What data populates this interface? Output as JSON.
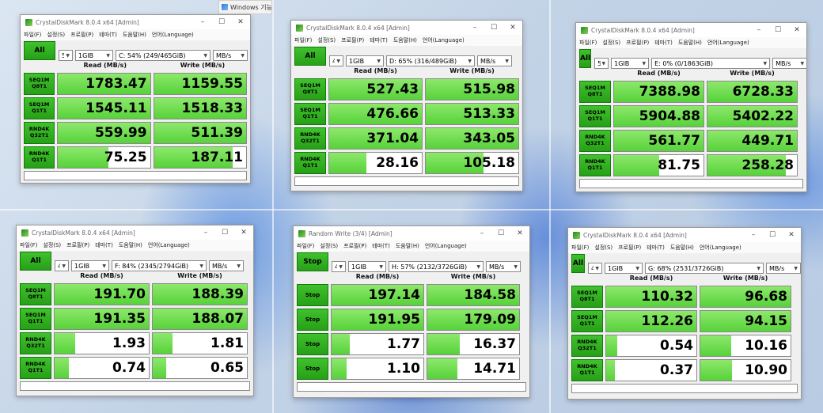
{
  "background_tab": {
    "label": "Windows 기능 P"
  },
  "common": {
    "menu": [
      "파일(F)",
      "설정(S)",
      "프로필(P)",
      "테마(T)",
      "도움말(H)",
      "언어(Language)"
    ],
    "read_header": "Read (MB/s)",
    "write_header": "Write (MB/s)",
    "count": "5",
    "size": "1GIB"
  },
  "windows": [
    {
      "title": "CrystalDiskMark 8.0.4 x64 [Admin]",
      "action": "All",
      "count": "5",
      "size": "1GIB",
      "drive": "C: 54% (249/465GiB)",
      "unit": "MB/s",
      "tests": [
        {
          "t1": "SEQ1M",
          "t2": "Q8T1",
          "read": "1783.47",
          "write": "1159.55",
          "rf": 1.0,
          "wf": 1.0
        },
        {
          "t1": "SEQ1M",
          "t2": "Q1T1",
          "read": "1545.11",
          "write": "1518.33",
          "rf": 1.0,
          "wf": 1.0
        },
        {
          "t1": "RND4K",
          "t2": "Q32T1",
          "read": "559.99",
          "write": "511.39",
          "rf": 1.0,
          "wf": 1.0
        },
        {
          "t1": "RND4K",
          "t2": "Q1T1",
          "read": "75.25",
          "write": "187.11",
          "rf": 0.55,
          "wf": 0.85
        }
      ]
    },
    {
      "title": "CrystalDiskMark 8.0.4 x64 [Admin]",
      "action": "All",
      "count": "4",
      "size": "1GIB",
      "drive": "D: 65% (316/489GiB)",
      "unit": "MB/s",
      "tests": [
        {
          "t1": "SEQ1M",
          "t2": "Q8T1",
          "read": "527.43",
          "write": "515.98",
          "rf": 1.0,
          "wf": 1.0
        },
        {
          "t1": "SEQ1M",
          "t2": "Q1T1",
          "read": "476.66",
          "write": "513.33",
          "rf": 1.0,
          "wf": 1.0
        },
        {
          "t1": "RND4K",
          "t2": "Q32T1",
          "read": "371.04",
          "write": "343.05",
          "rf": 1.0,
          "wf": 1.0
        },
        {
          "t1": "RND4K",
          "t2": "Q1T1",
          "read": "28.16",
          "write": "105.18",
          "rf": 0.4,
          "wf": 0.62
        }
      ]
    },
    {
      "title": "CrystalDiskMark 8.0.4 x64 [Admin]",
      "action": "All",
      "count": "5",
      "size": "1GIB",
      "drive": "E: 0% (0/1863GiB)",
      "unit": "MB/s",
      "tests": [
        {
          "t1": "SEQ1M",
          "t2": "Q8T1",
          "read": "7388.98",
          "write": "6728.33",
          "rf": 1.0,
          "wf": 1.0
        },
        {
          "t1": "SEQ1M",
          "t2": "Q1T1",
          "read": "5904.88",
          "write": "5402.22",
          "rf": 1.0,
          "wf": 1.0
        },
        {
          "t1": "RND4K",
          "t2": "Q32T1",
          "read": "561.77",
          "write": "449.71",
          "rf": 1.0,
          "wf": 1.0
        },
        {
          "t1": "RND4K",
          "t2": "Q1T1",
          "read": "81.75",
          "write": "258.28",
          "rf": 0.5,
          "wf": 0.88
        }
      ]
    },
    {
      "title": "CrystalDiskMark 8.0.4 x64 [Admin]",
      "action": "All",
      "count": "4",
      "size": "1GIB",
      "drive": "F: 84% (2345/2794GiB)",
      "unit": "MB/s",
      "tests": [
        {
          "t1": "SEQ1M",
          "t2": "Q8T1",
          "read": "191.70",
          "write": "188.39",
          "rf": 1.0,
          "wf": 1.0
        },
        {
          "t1": "SEQ1M",
          "t2": "Q1T1",
          "read": "191.35",
          "write": "188.07",
          "rf": 1.0,
          "wf": 1.0
        },
        {
          "t1": "RND4K",
          "t2": "Q32T1",
          "read": "1.93",
          "write": "1.81",
          "rf": 0.22,
          "wf": 0.21
        },
        {
          "t1": "RND4K",
          "t2": "Q1T1",
          "read": "0.74",
          "write": "0.65",
          "rf": 0.15,
          "wf": 0.14
        }
      ]
    },
    {
      "title": "Random Write (3/4) [Admin]",
      "action": "Stop",
      "count": "4",
      "size": "1GIB",
      "drive": "H: 57% (2132/3726GiB)",
      "unit": "MB/s",
      "tests": [
        {
          "t1": "Stop",
          "t2": "",
          "read": "197.14",
          "write": "184.58",
          "rf": 1.0,
          "wf": 1.0
        },
        {
          "t1": "Stop",
          "t2": "",
          "read": "191.95",
          "write": "179.09",
          "rf": 1.0,
          "wf": 1.0
        },
        {
          "t1": "Stop",
          "t2": "",
          "read": "1.77",
          "write": "16.37",
          "rf": 0.2,
          "wf": 0.35
        },
        {
          "t1": "Stop",
          "t2": "",
          "read": "1.10",
          "write": "14.71",
          "rf": 0.16,
          "wf": 0.33
        }
      ]
    },
    {
      "title": "CrystalDiskMark 8.0.4 x64 [Admin]",
      "action": "All",
      "count": "4",
      "size": "1GIB",
      "drive": "G: 68% (2531/3726GiB)",
      "unit": "MB/s",
      "tests": [
        {
          "t1": "SEQ1M",
          "t2": "Q8T1",
          "read": "110.32",
          "write": "96.68",
          "rf": 1.0,
          "wf": 1.0
        },
        {
          "t1": "SEQ1M",
          "t2": "Q1T1",
          "read": "112.26",
          "write": "94.15",
          "rf": 1.0,
          "wf": 1.0
        },
        {
          "t1": "RND4K",
          "t2": "Q32T1",
          "read": "0.54",
          "write": "10.16",
          "rf": 0.12,
          "wf": 0.34
        },
        {
          "t1": "RND4K",
          "t2": "Q1T1",
          "read": "0.37",
          "write": "10.90",
          "rf": 0.1,
          "wf": 0.35
        }
      ]
    }
  ]
}
